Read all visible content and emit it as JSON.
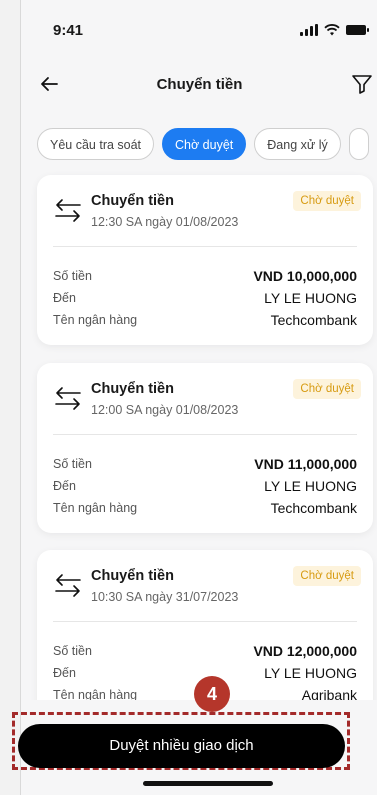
{
  "status_bar": {
    "time": "9:41"
  },
  "nav": {
    "title": "Chuyển tiền"
  },
  "tabs": [
    {
      "label": "Yêu cầu tra soát",
      "active": false
    },
    {
      "label": "Chờ duyệt",
      "active": true
    },
    {
      "label": "Đang xử lý",
      "active": false
    }
  ],
  "cards": [
    {
      "title": "Chuyển tiền",
      "time": "12:30 SA ngày 01/08/2023",
      "status": "Chờ duyệt",
      "rows": [
        {
          "label": "Số tiền",
          "value": "VND 10,000,000"
        },
        {
          "label": "Đến",
          "value": "LY LE HUONG"
        },
        {
          "label": "Tên ngân hàng",
          "value": "Techcombank"
        }
      ]
    },
    {
      "title": "Chuyển tiền",
      "time": "12:00 SA ngày 01/08/2023",
      "status": "Chờ duyệt",
      "rows": [
        {
          "label": "Số tiền",
          "value": "VND 11,000,000"
        },
        {
          "label": "Đến",
          "value": "LY LE HUONG"
        },
        {
          "label": "Tên ngân hàng",
          "value": "Techcombank"
        }
      ]
    },
    {
      "title": "Chuyển tiền",
      "time": "10:30 SA ngày 31/07/2023",
      "status": "Chờ duyệt",
      "rows": [
        {
          "label": "Số tiền",
          "value": "VND 12,000,000"
        },
        {
          "label": "Đến",
          "value": "LY LE HUONG"
        },
        {
          "label": "Tên ngân hàng",
          "value": "Agribank"
        }
      ]
    }
  ],
  "annotation": {
    "step": "4"
  },
  "primary_action": {
    "label": "Duyệt nhiều giao dịch"
  },
  "colors": {
    "accent": "#1d7cf2",
    "badge_bg": "#fdf3dc",
    "badge_text": "#d79b12",
    "annotation": "#a32a2a"
  },
  "icons": {
    "back": "arrow-left-icon",
    "filter": "filter-icon",
    "transfer": "transfer-arrows-icon"
  }
}
